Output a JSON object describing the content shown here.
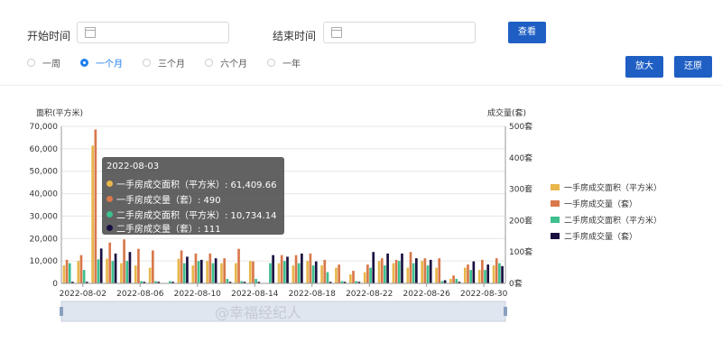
{
  "filters": {
    "start_label": "开始时间",
    "end_label": "结束时间",
    "query_button": "查看",
    "zoom_in_button": "放大",
    "reset_button": "还原"
  },
  "periods": [
    {
      "label": "一周",
      "selected": false
    },
    {
      "label": "一个月",
      "selected": true
    },
    {
      "label": "三个月",
      "selected": false
    },
    {
      "label": "六个月",
      "selected": false
    },
    {
      "label": "一年",
      "selected": false
    }
  ],
  "tooltip": {
    "title": "2022-08-03",
    "rows": [
      {
        "text": "一手房成交面积（平方米）: 61,409.66",
        "color": "#e8b64a"
      },
      {
        "text": "一手房成交量（套）: 490",
        "color": "#d9784a"
      },
      {
        "text": "二手房成交面积（平方米）: 10,734.14",
        "color": "#3dbf8e"
      },
      {
        "text": "二手房成交量（套）: 111",
        "color": "#1a1040"
      }
    ]
  },
  "watermark": "@幸福经纪人",
  "chart_data": {
    "type": "bar",
    "ylabel_left": "面积(平方米)",
    "ylabel_right": "成交量(套)",
    "ylim_left": [
      0,
      70000
    ],
    "ylim_right": [
      0,
      500
    ],
    "left_ticks": [
      "0",
      "10,000",
      "20,000",
      "30,000",
      "40,000",
      "50,000",
      "60,000",
      "70,000"
    ],
    "right_ticks": [
      "0套",
      "100套",
      "200套",
      "300套",
      "400套",
      "500套"
    ],
    "x_tick_labels": [
      "2022-08-02",
      "2022-08-06",
      "2022-08-10",
      "2022-08-14",
      "2022-08-18",
      "2022-08-22",
      "2022-08-26",
      "2022-08-30"
    ],
    "grid": true,
    "legend_position": "right",
    "categories": [
      "2022-08-01",
      "2022-08-02",
      "2022-08-03",
      "2022-08-04",
      "2022-08-05",
      "2022-08-06",
      "2022-08-07",
      "2022-08-08",
      "2022-08-09",
      "2022-08-10",
      "2022-08-11",
      "2022-08-12",
      "2022-08-13",
      "2022-08-14",
      "2022-08-15",
      "2022-08-16",
      "2022-08-17",
      "2022-08-18",
      "2022-08-19",
      "2022-08-20",
      "2022-08-21",
      "2022-08-22",
      "2022-08-23",
      "2022-08-24",
      "2022-08-25",
      "2022-08-26",
      "2022-08-27",
      "2022-08-28",
      "2022-08-29",
      "2022-08-30",
      "2022-08-31"
    ],
    "series": [
      {
        "name": "一手房成交面积（平方米）",
        "axis": "left",
        "color": "#e8b64a",
        "values": [
          8000,
          10000,
          61410,
          11000,
          9000,
          8000,
          7000,
          0,
          11000,
          8000,
          10000,
          9000,
          9000,
          10000,
          0,
          9000,
          8000,
          10000,
          8000,
          7000,
          4000,
          5000,
          10000,
          9000,
          7000,
          10000,
          7000,
          2000,
          7000,
          6000,
          8000
        ]
      },
      {
        "name": "一手房成交量（套）",
        "axis": "right",
        "color": "#d9784a",
        "values": [
          75,
          90,
          490,
          130,
          140,
          110,
          105,
          0,
          105,
          95,
          95,
          80,
          110,
          70,
          0,
          90,
          90,
          95,
          75,
          60,
          40,
          60,
          80,
          75,
          100,
          80,
          80,
          25,
          60,
          75,
          80
        ]
      },
      {
        "name": "二手房成交面积（平方米）",
        "axis": "left",
        "color": "#3dbf8e",
        "values": [
          9000,
          6000,
          10734,
          10000,
          10000,
          1000,
          1000,
          1000,
          9000,
          10000,
          9000,
          2000,
          1000,
          2000,
          9000,
          10000,
          9000,
          8000,
          5000,
          1000,
          1000,
          7000,
          8000,
          10000,
          9000,
          8000,
          1000,
          2000,
          6000,
          6000,
          9000
        ]
      },
      {
        "name": "二手房成交量（套）",
        "axis": "right",
        "color": "#1a1040",
        "values": [
          5,
          5,
          111,
          95,
          100,
          5,
          5,
          5,
          85,
          75,
          80,
          5,
          5,
          5,
          90,
          85,
          95,
          70,
          5,
          5,
          5,
          100,
          95,
          95,
          80,
          75,
          10,
          5,
          70,
          60,
          55
        ]
      }
    ]
  }
}
